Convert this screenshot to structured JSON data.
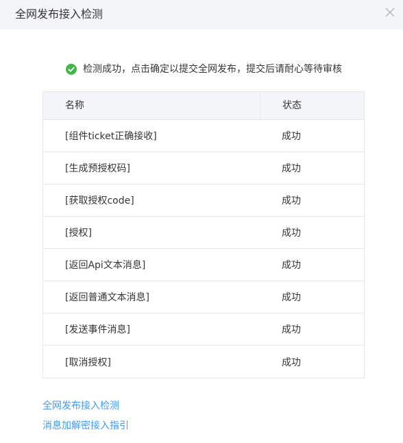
{
  "dialog": {
    "title": "全网发布接入检测"
  },
  "notice": {
    "message": "检测成功，点击确定以提交全网发布，提交后请耐心等待审核"
  },
  "table": {
    "headers": {
      "name": "名称",
      "status": "状态"
    },
    "rows": [
      {
        "name": "[组件ticket正确接收]",
        "status": "成功"
      },
      {
        "name": "[生成预授权码]",
        "status": "成功"
      },
      {
        "name": "[获取授权code]",
        "status": "成功"
      },
      {
        "name": "[授权]",
        "status": "成功"
      },
      {
        "name": "[返回Api文本消息]",
        "status": "成功"
      },
      {
        "name": "[返回普通文本消息]",
        "status": "成功"
      },
      {
        "name": "[发送事件消息]",
        "status": "成功"
      },
      {
        "name": "[取消授权]",
        "status": "成功"
      }
    ]
  },
  "links": [
    {
      "label": "全网发布接入检测"
    },
    {
      "label": "消息加解密接入指引"
    }
  ],
  "colors": {
    "accent_link": "#459ae9",
    "success_green": "#44b549",
    "header_bg": "#f4f5f9",
    "border": "#e7e7eb"
  },
  "icons": {
    "close": "close-icon",
    "success": "success-check-icon"
  }
}
